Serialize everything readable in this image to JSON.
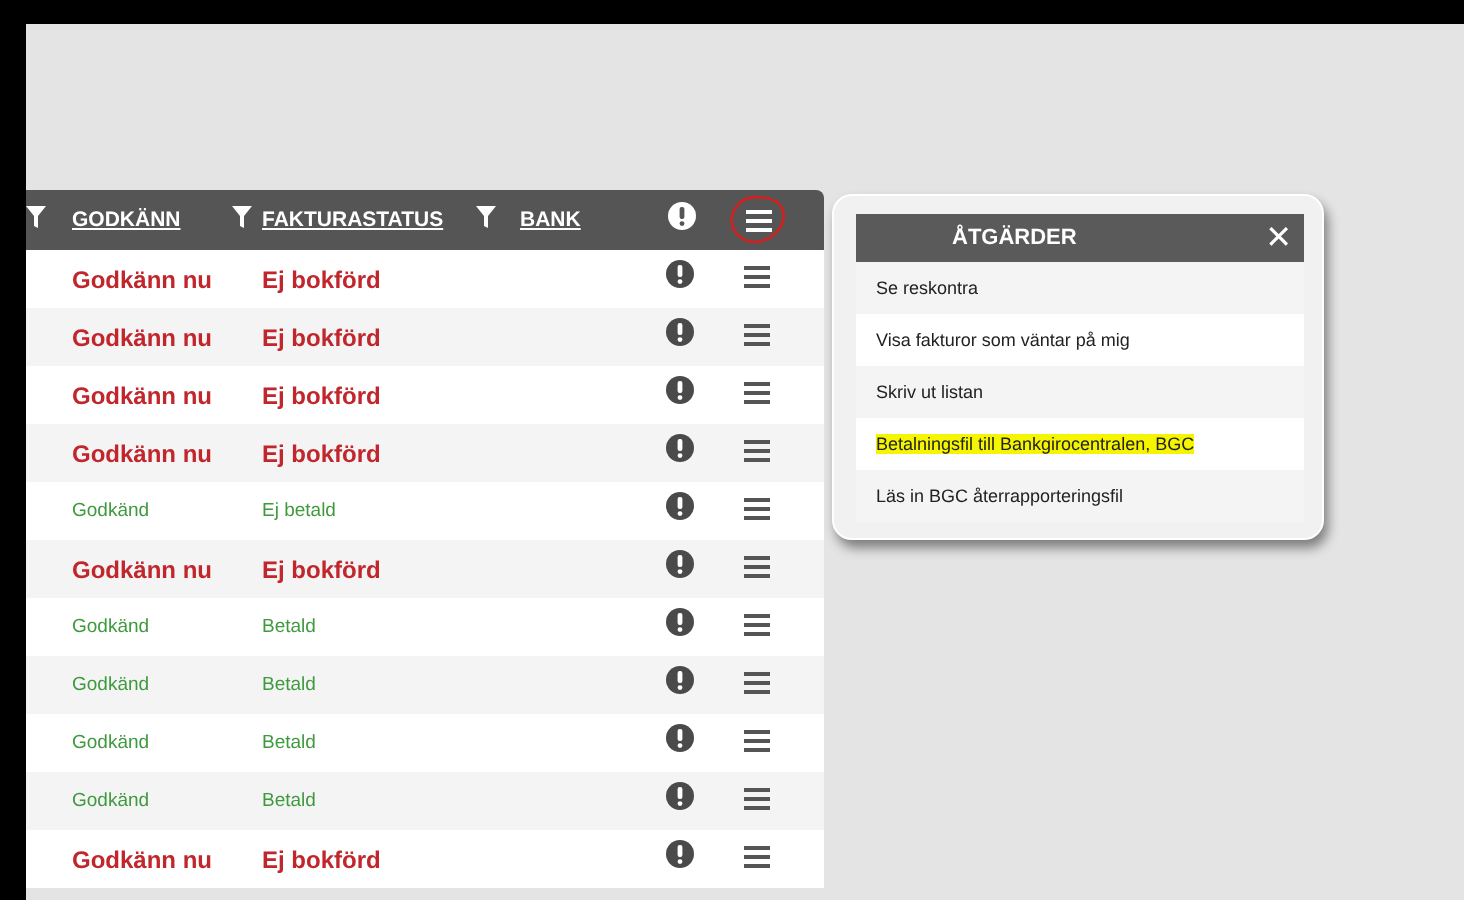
{
  "table": {
    "columns": [
      {
        "label": "GODKÄNN",
        "filter": true
      },
      {
        "label": "FAKTURASTATUS",
        "filter": true
      },
      {
        "label": "BANK",
        "filter": false
      }
    ],
    "leading_filter": true,
    "menu_circled": true,
    "rows": [
      {
        "kind": "pending",
        "approval": "Godkänn nu",
        "status": "Ej bokförd"
      },
      {
        "kind": "pending",
        "approval": "Godkänn nu",
        "status": "Ej bokförd"
      },
      {
        "kind": "pending",
        "approval": "Godkänn nu",
        "status": "Ej bokförd"
      },
      {
        "kind": "pending",
        "approval": "Godkänn nu",
        "status": "Ej bokförd"
      },
      {
        "kind": "done",
        "approval": "Godkänd",
        "status": "Ej betald"
      },
      {
        "kind": "pending",
        "approval": "Godkänn nu",
        "status": "Ej bokförd"
      },
      {
        "kind": "done",
        "approval": "Godkänd",
        "status": "Betald"
      },
      {
        "kind": "done",
        "approval": "Godkänd",
        "status": "Betald"
      },
      {
        "kind": "done",
        "approval": "Godkänd",
        "status": "Betald"
      },
      {
        "kind": "done",
        "approval": "Godkänd",
        "status": "Betald"
      },
      {
        "kind": "pending",
        "approval": "Godkänn nu",
        "status": "Ej bokförd"
      }
    ]
  },
  "actions_menu": {
    "title": "ÅTGÄRDER",
    "close": "✕",
    "items": [
      {
        "label": "Se reskontra",
        "highlighted": false
      },
      {
        "label": "Visa fakturor som väntar på mig",
        "highlighted": false
      },
      {
        "label": "Skriv ut listan",
        "highlighted": false
      },
      {
        "label": "Betalningsfil till Bankgirocentralen, BGC",
        "highlighted": true
      },
      {
        "label": "Läs in BGC återrapporteringsfil",
        "highlighted": false
      }
    ]
  }
}
